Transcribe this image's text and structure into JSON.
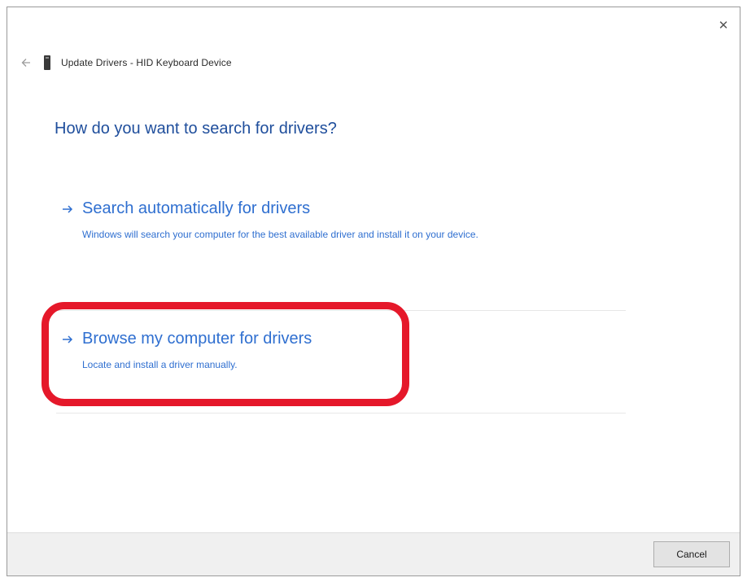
{
  "window": {
    "title": "Update Drivers - HID Keyboard Device",
    "close_glyph": "✕"
  },
  "heading": "How do you want to search for drivers?",
  "options": [
    {
      "title": "Search automatically for drivers",
      "description": "Windows will search your computer for the best available driver and install it on your device."
    },
    {
      "title": "Browse my computer for drivers",
      "description": "Locate and install a driver manually."
    }
  ],
  "footer": {
    "cancel_label": "Cancel"
  },
  "icons": {
    "back": "back-arrow-icon",
    "device": "keyboard-device-icon",
    "option_arrow": "right-arrow-icon",
    "close": "close-icon"
  },
  "colors": {
    "heading": "#1f4e9c",
    "link": "#2f6fd0",
    "highlight": "#e5182a",
    "footer_bg": "#f0f0f0"
  }
}
